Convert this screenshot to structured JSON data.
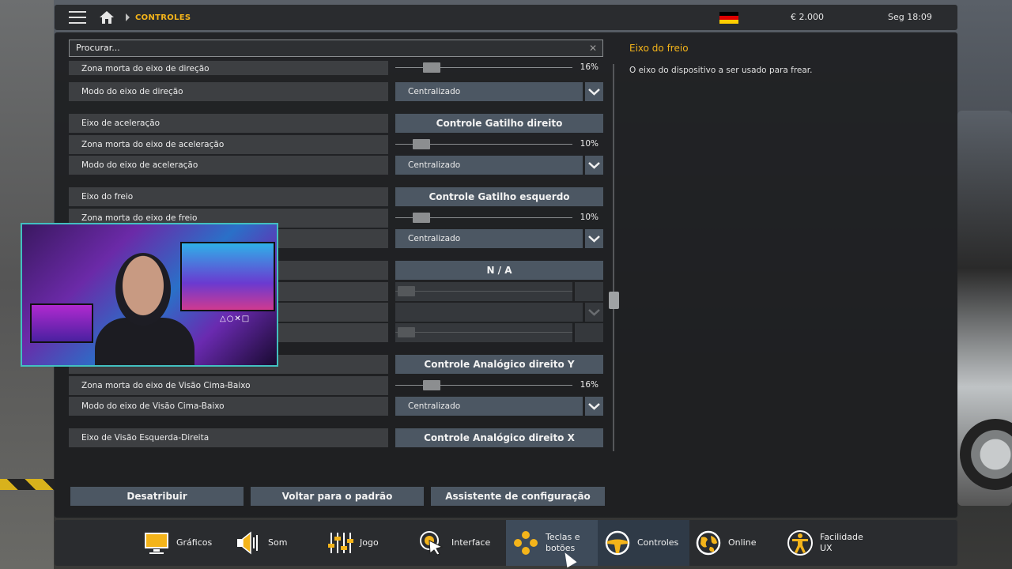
{
  "topbar": {
    "breadcrumb": "CONTROLES",
    "money": "€ 2.000",
    "clock": "Seg 18:09"
  },
  "search": {
    "value": "Procurar..."
  },
  "rows": [
    {
      "label": "Zona morta do eixo de direção",
      "type": "slider",
      "value": 16,
      "display": "16%"
    },
    {
      "label": "Modo do eixo de direção",
      "type": "dropdown",
      "value": "Centralizado"
    },
    {
      "label": "Eixo de aceleração",
      "type": "button",
      "value": "Controle Gatilho direito"
    },
    {
      "label": "Zona morta do eixo de aceleração",
      "type": "slider",
      "value": 10,
      "display": "10%"
    },
    {
      "label": "Modo do eixo de aceleração",
      "type": "dropdown",
      "value": "Centralizado"
    },
    {
      "label": "Eixo do freio",
      "type": "button",
      "value": "Controle Gatilho esquerdo"
    },
    {
      "label": "Zona morta do eixo de freio",
      "type": "slider",
      "value": 10,
      "display": "10%"
    },
    {
      "label": "",
      "type": "dropdown",
      "value": "Centralizado"
    },
    {
      "label": "",
      "type": "button",
      "value": "N / A"
    },
    {
      "label": "",
      "type": "slider-disabled"
    },
    {
      "label": "",
      "type": "dropdown-disabled"
    },
    {
      "label": "",
      "type": "slider-disabled"
    },
    {
      "label": "",
      "type": "button",
      "value": "Controle Analógico direito Y"
    },
    {
      "label": "Zona morta do eixo de Visão Cima-Baixo",
      "type": "slider",
      "value": 16,
      "display": "16%"
    },
    {
      "label": "Modo do eixo de Visão Cima-Baixo",
      "type": "dropdown",
      "value": "Centralizado"
    },
    {
      "label": "Eixo de Visão Esquerda-Direita",
      "type": "button",
      "value": "Controle Analógico direito X"
    }
  ],
  "actions": {
    "unassign": "Desatribuir",
    "reset": "Voltar para o padrão",
    "wizard": "Assistente de configuração"
  },
  "help": {
    "title": "Eixo do freio",
    "text": "O eixo do dispositivo a ser usado para frear."
  },
  "nav": [
    {
      "label": "Gráficos",
      "icon": "monitor-icon"
    },
    {
      "label": "Som",
      "icon": "speaker-icon"
    },
    {
      "label": "Jogo",
      "icon": "sliders-icon"
    },
    {
      "label": "Interface",
      "icon": "cursor-target-icon"
    },
    {
      "label": "Teclas e botões",
      "icon": "gamepad-dots-icon"
    },
    {
      "label": "Controles",
      "icon": "steering-wheel-icon"
    },
    {
      "label": "Online",
      "icon": "globe-icon"
    },
    {
      "label": "Facilidade UX",
      "icon": "accessibility-icon"
    }
  ],
  "colors": {
    "accent": "#f4b41a",
    "button": "#4c5763",
    "row": "#3d3f42"
  }
}
